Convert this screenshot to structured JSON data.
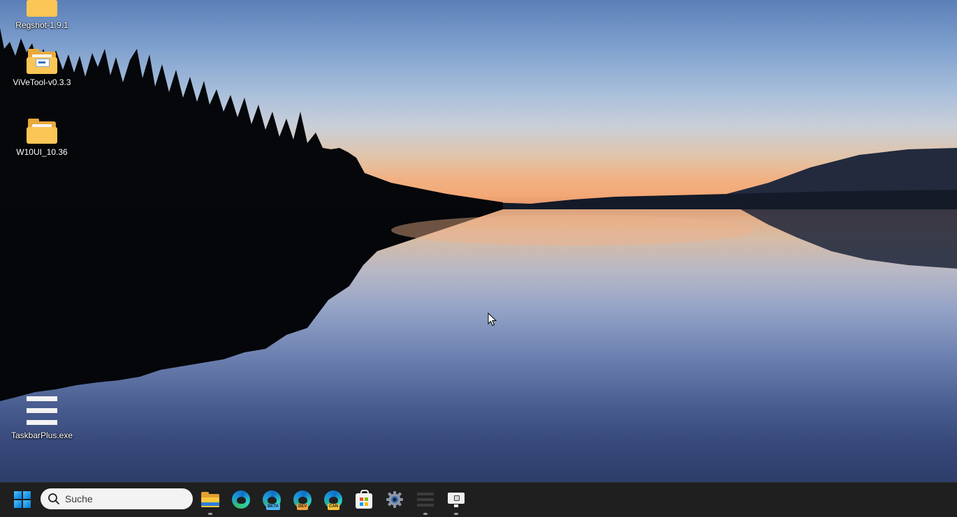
{
  "desktop": {
    "icons": [
      {
        "label": "Regshot-1.9.1",
        "icon": "folder-icon"
      },
      {
        "label": "ViVeTool-v0.3.3",
        "icon": "folder-icon"
      },
      {
        "label": "W10UI_10.36",
        "icon": "folder-icon"
      },
      {
        "label": "TaskbarPlus.exe",
        "icon": "taskbarplus-icon"
      }
    ],
    "wallpaper": "lake-sunset"
  },
  "taskbar": {
    "search": {
      "placeholder": "Suche"
    },
    "pinned": [
      {
        "name": "start",
        "icon": "windows-logo-icon"
      },
      {
        "name": "file-explorer",
        "icon": "folder-icon",
        "running": true
      },
      {
        "name": "edge",
        "icon": "edge-icon"
      },
      {
        "name": "edge-beta",
        "icon": "edge-beta-icon",
        "badge": "BETA"
      },
      {
        "name": "edge-dev",
        "icon": "edge-dev-icon",
        "badge": "DEV"
      },
      {
        "name": "edge-canary",
        "icon": "edge-canary-icon",
        "badge": "CAN"
      },
      {
        "name": "store",
        "icon": "store-icon"
      },
      {
        "name": "settings",
        "icon": "gear-icon"
      },
      {
        "name": "taskbarplus",
        "icon": "taskbarplus-icon",
        "running": true
      },
      {
        "name": "monitor-app",
        "icon": "monitor-icon",
        "running": true
      }
    ],
    "colors": {
      "background": "#1f1f1f",
      "accent": "#0078d4"
    }
  }
}
